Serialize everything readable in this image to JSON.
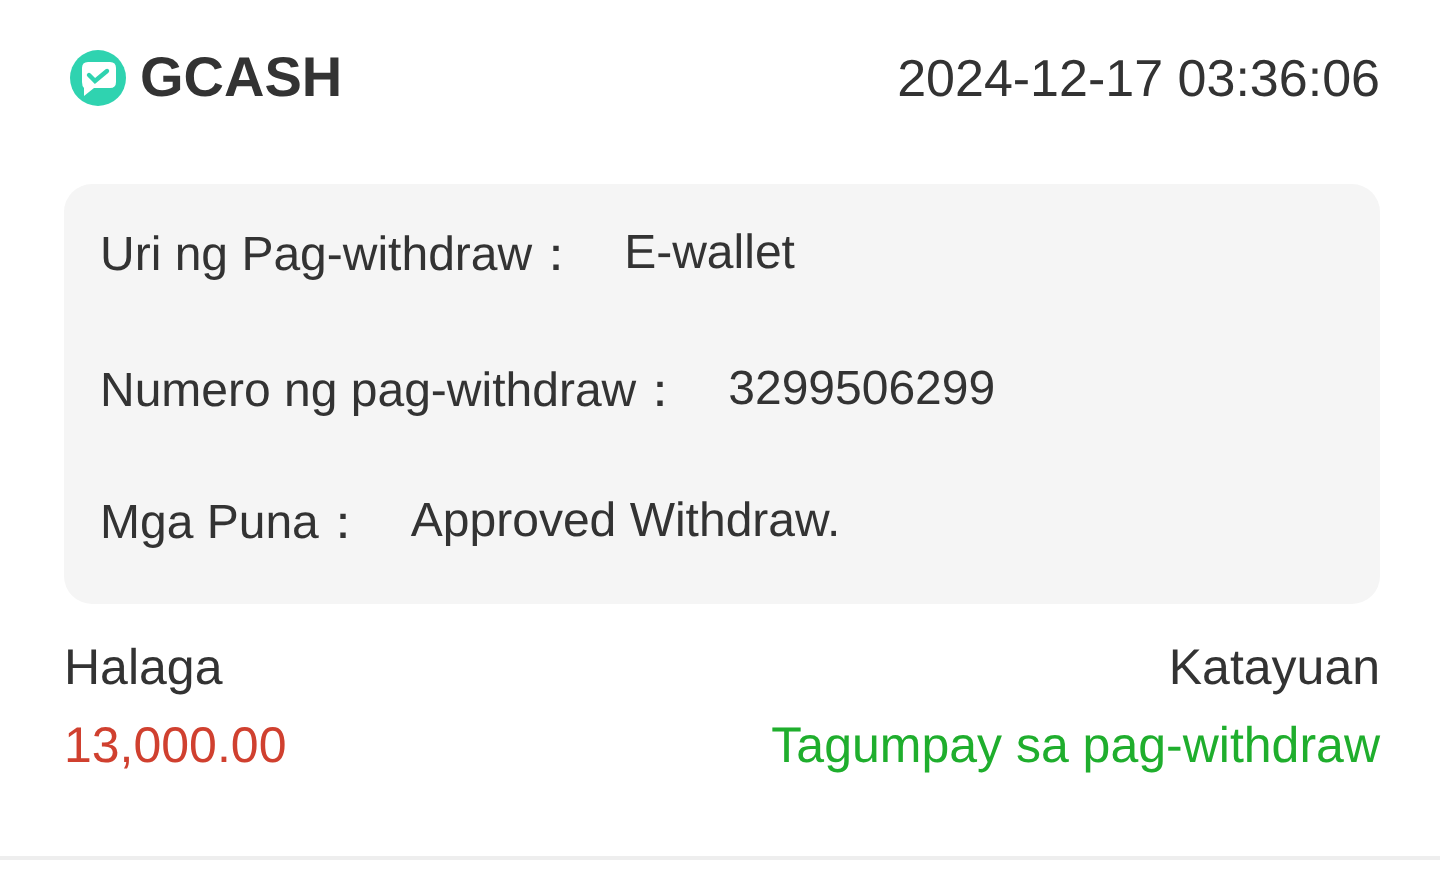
{
  "header": {
    "brand": "GCASH",
    "datetime": "2024-12-17 03:36:06"
  },
  "details": [
    {
      "label": "Uri ng Pag-withdraw：",
      "value": "E-wallet"
    },
    {
      "label": "Numero ng pag-withdraw：",
      "value": "3299506299"
    },
    {
      "label": "Mga Puna：",
      "value": "Approved Withdraw."
    }
  ],
  "summary": {
    "amount_label": "Halaga",
    "amount": "13,000.00",
    "status_label": "Katayuan",
    "status": "Tagumpay sa pag-withdraw"
  }
}
